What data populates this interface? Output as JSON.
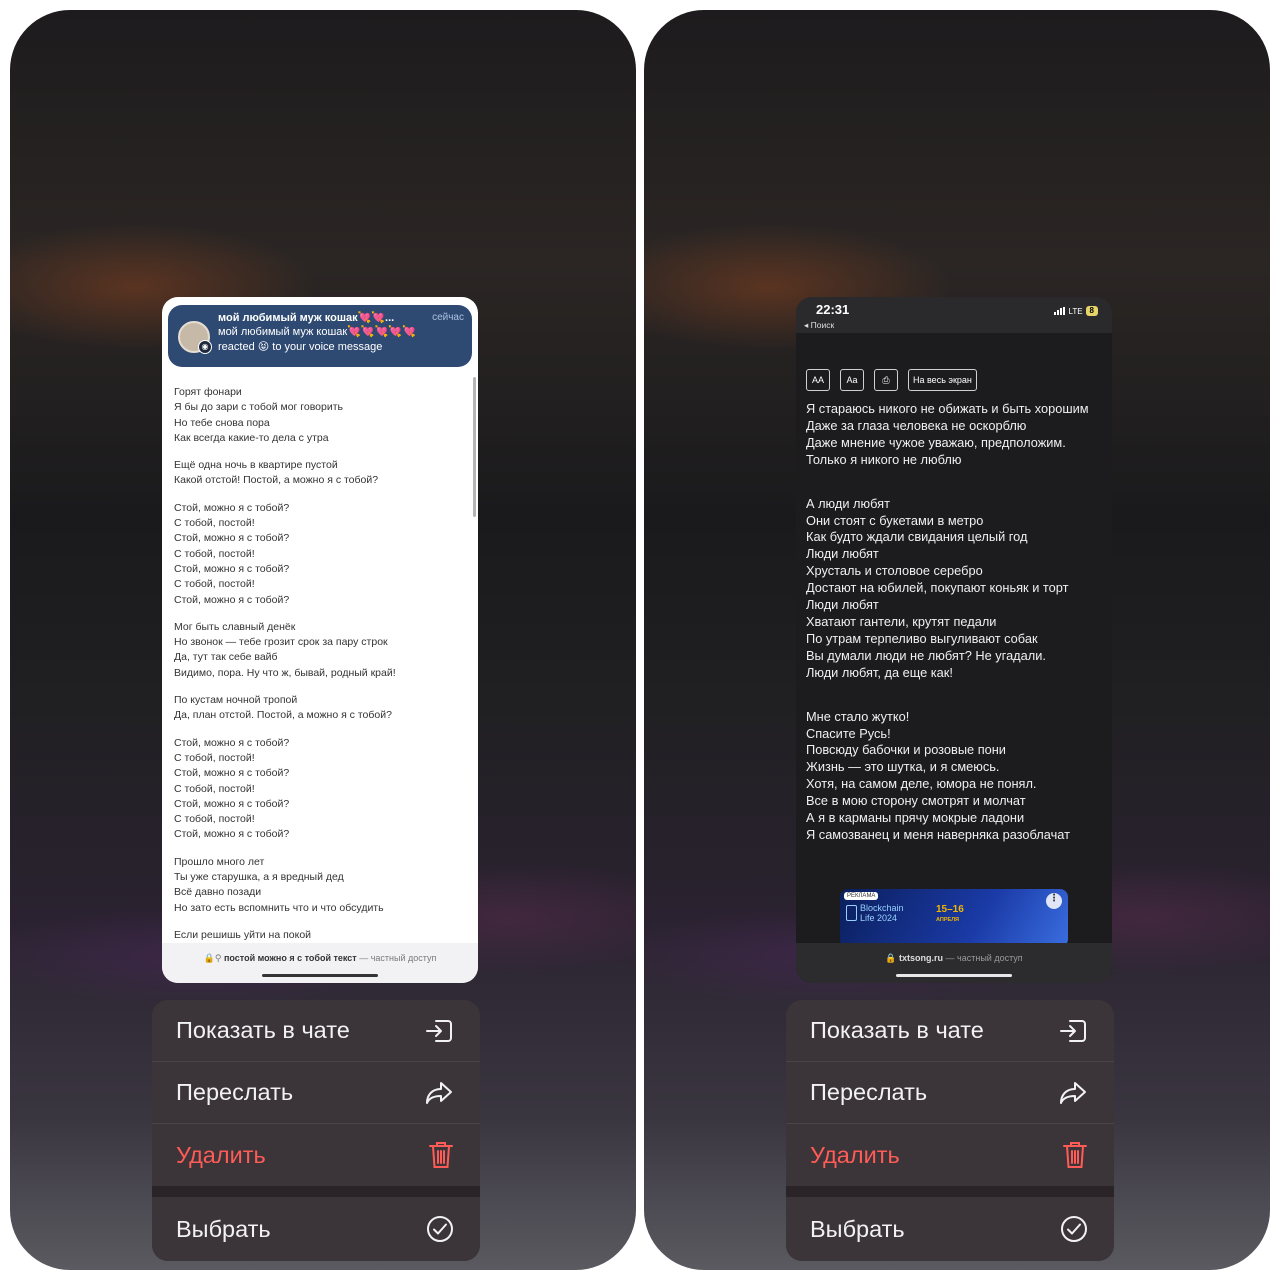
{
  "left": {
    "notification": {
      "title": "мой любимый муж кошак💘💘...",
      "time": "сейчас",
      "line1": "мой любимый муж кошак💘💘💘💘💘",
      "line2": "reacted 😝 to your voice message"
    },
    "lyrics": [
      [
        "Горят фонари",
        "Я бы до зари с тобой мог говорить",
        "Но тебе снова пора",
        "Как всегда какие-то дела с утра"
      ],
      [
        "Ещё одна ночь в квартире пустой",
        "Какой отстой! Постой, а можно я с тобой?"
      ],
      [
        "Стой, можно я с тобой?",
        "С тобой, постой!",
        "Стой, можно я с тобой?",
        "С тобой, постой!",
        "Стой, можно я с тобой?",
        "С тобой, постой!",
        "Стой, можно я с тобой?"
      ],
      [
        "Мог быть славный денёк",
        "Но звонок — тебе грозит срок за пару строк",
        "Да, тут так себе вайб",
        "Видимо, пора. Ну что ж, бывай, родный край!"
      ],
      [
        "По кустам ночной тропой",
        "Да, план отстой. Постой, а можно я с тобой?"
      ],
      [
        "Стой, можно я с тобой?",
        "С тобой, постой!",
        "Стой, можно я с тобой?",
        "С тобой, постой!",
        "Стой, можно я с тобой?",
        "С тобой, постой!",
        "Стой, можно я с тобой?"
      ],
      [
        "Прошло много лет",
        "Ты уже старушка, а я вредный дед",
        "Всё давно позади",
        "Но зато есть вспомнить что и что обсудить"
      ],
      [
        "Если решишь уйти на покой"
      ]
    ],
    "url": {
      "query": "постой можно я с тобой текст",
      "suffix": " — частный доступ"
    }
  },
  "right": {
    "status": {
      "time": "22:31",
      "back": "◂ Поиск",
      "network": "LTE",
      "battery": "8"
    },
    "toolbar": {
      "b1": "AA",
      "b2": "Aa",
      "b4": "На весь экран"
    },
    "lyrics": [
      [
        "Я стараюсь никого не обижать и быть хорошим",
        "Даже за глаза человека не оскорблю",
        "Даже мнение чужое уважаю,  предположим.",
        "Только я никого не люблю"
      ],
      [
        "А люди любят",
        "Они стоят с букетами в метро",
        "Как будто ждали свидания целый год",
        "Люди любят",
        "Хрусталь и столовое серебро",
        "Достают на юбилей, покупают коньяк и торт",
        "Люди любят",
        "Хватают гантели, крутят педали",
        "По утрам терпеливо выгуливают собак",
        "Вы думали люди не любят? Не угадали.",
        "Люди любят, да еще как!"
      ],
      [
        "Мне стало жутко!",
        "Спасите Русь!",
        "Повсюду бабочки и розовые пони",
        "Жизнь — это шутка, и я смеюсь.",
        "Хотя, на самом деле, юмора не понял.",
        "Все в мою сторону смотрят и молчат",
        "А я в карманы прячу мокрые ладони",
        "Я самозванец и меня наверняка разоблачат"
      ]
    ],
    "ad": {
      "tag": "РЕКЛАМА",
      "brand1": "Blockchain",
      "brand2": "Life 2024",
      "dates": "15–16",
      "month": "АПРЕЛЯ"
    },
    "url": {
      "domain": "txtsong.ru",
      "suffix": " — частный доступ"
    }
  },
  "menu": {
    "show_in_chat": "Показать в чате",
    "forward": "Переслать",
    "delete": "Удалить",
    "select": "Выбрать"
  },
  "colors": {
    "danger": "#ff5c57",
    "banner": "#2f4a72"
  }
}
